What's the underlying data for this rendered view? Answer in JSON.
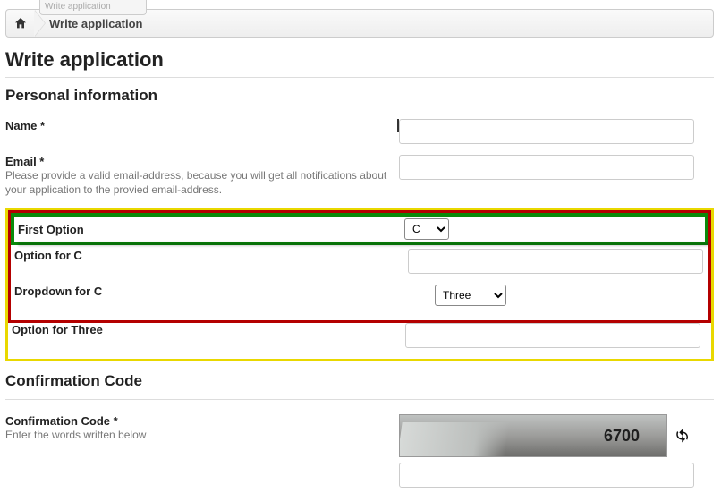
{
  "tab_stub": "Write application",
  "breadcrumb": {
    "current": "Write application"
  },
  "page_title": "Write application",
  "section_personal": "Personal information",
  "fields": {
    "name": {
      "label": "Name *"
    },
    "email": {
      "label": "Email *",
      "help": "Please provide a valid email-address, because you will get all notifications about your application to the provied email-address."
    },
    "first_option": {
      "label": "First Option",
      "value": "C"
    },
    "option_for_c": {
      "label": "Option for C"
    },
    "dropdown_for_c": {
      "label": "Dropdown for C",
      "value": "Three"
    },
    "option_for_three": {
      "label": "Option for Three"
    }
  },
  "section_confirm": "Confirmation Code",
  "confirm": {
    "label": "Confirmation Code *",
    "help": "Enter the words written below",
    "captcha_text": "6700"
  }
}
